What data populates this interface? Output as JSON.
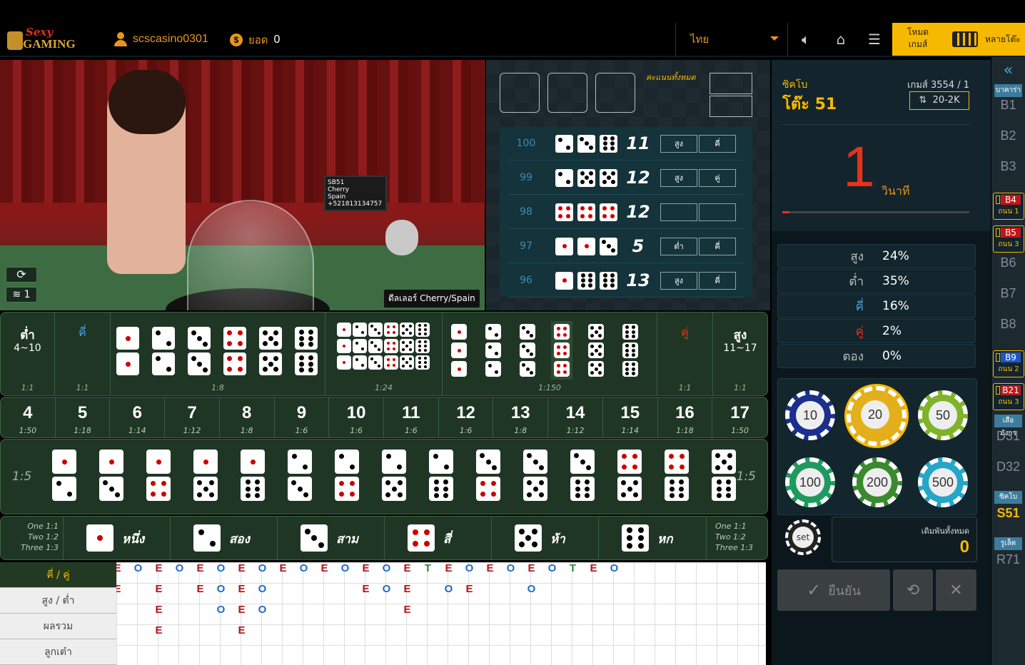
{
  "topbar": {
    "logo_line1": "Sexy",
    "logo_line2": "GAMING",
    "username": "scscasino0301",
    "balance_label": "ยอด",
    "balance_value": "0",
    "language": "ไทย",
    "game_mode": "โหมด\nเกมส์",
    "multi_table": "หลายโต๊ะ"
  },
  "video": {
    "dealer_label": "ดีลเลอร์ Cherry/Spain",
    "signal_level": "1",
    "screen_text": "SB51\nCherry\nSpain\n+521813134757"
  },
  "results": {
    "score_label": "คะแนนทั้งหมด",
    "history": [
      {
        "round": "100",
        "dice": [
          2,
          3,
          6
        ],
        "sum": "11",
        "hl": "สูง",
        "oe": "คี่"
      },
      {
        "round": "99",
        "dice": [
          2,
          5,
          5
        ],
        "sum": "12",
        "hl": "สูง",
        "oe": "คู่"
      },
      {
        "round": "98",
        "dice": [
          4,
          4,
          4
        ],
        "sum": "12",
        "hl": "",
        "oe": ""
      },
      {
        "round": "97",
        "dice": [
          1,
          1,
          3
        ],
        "sum": "5",
        "hl": "ต่ำ",
        "oe": "คี่"
      },
      {
        "round": "96",
        "dice": [
          1,
          6,
          6
        ],
        "sum": "13",
        "hl": "สูง",
        "oe": "คี่"
      }
    ]
  },
  "board": {
    "low_label": "ต่ำ",
    "low_range": "4~10",
    "low_odds": "1:1",
    "odd_label": "คี่",
    "odd_odds": "1:1",
    "double_odds": "1:8",
    "any_triple_odds": "1:24",
    "triple_odds": "1:150",
    "even_label": "คู่",
    "even_odds": "1:1",
    "high_label": "สูง",
    "high_range": "11~17",
    "high_odds": "1:1",
    "sums": [
      {
        "n": "4",
        "o": "1:50"
      },
      {
        "n": "5",
        "o": "1:18"
      },
      {
        "n": "6",
        "o": "1:14"
      },
      {
        "n": "7",
        "o": "1:12"
      },
      {
        "n": "8",
        "o": "1:8"
      },
      {
        "n": "9",
        "o": "1:6"
      },
      {
        "n": "10",
        "o": "1:6"
      },
      {
        "n": "11",
        "o": "1:6"
      },
      {
        "n": "12",
        "o": "1:6"
      },
      {
        "n": "13",
        "o": "1:8"
      },
      {
        "n": "14",
        "o": "1:12"
      },
      {
        "n": "15",
        "o": "1:14"
      },
      {
        "n": "16",
        "o": "1:18"
      },
      {
        "n": "17",
        "o": "1:50"
      }
    ],
    "combo_odds": "1:5",
    "single_odds_text": [
      "One 1:1",
      "Two 1:2",
      "Three 1:3"
    ],
    "singles": [
      "หนึ่ง",
      "สอง",
      "สาม",
      "สี่",
      "ห้า",
      "หก"
    ]
  },
  "roadmap": {
    "tabs": [
      "คี่ / คู่",
      "สูง / ต่ำ",
      "ผลรวม",
      "ลูกเต๋า"
    ],
    "row1": [
      "E",
      "O",
      "E",
      "O",
      "E",
      "O",
      "E",
      "O",
      "E",
      "O",
      "E",
      "O",
      "E",
      "O",
      "E",
      "T",
      "E",
      "O",
      "E",
      "O",
      "E",
      "O",
      "T",
      "E",
      "O"
    ],
    "row2": [
      "E",
      "",
      "E",
      "",
      "E",
      "O",
      "E",
      "O",
      "",
      "",
      "",
      "",
      "E",
      "O",
      "E",
      "",
      "O",
      "E",
      "",
      "",
      "O",
      "",
      "",
      "",
      ""
    ],
    "row3": [
      "",
      "",
      "E",
      "",
      "",
      "O",
      "E",
      "O",
      "",
      "",
      "",
      "",
      "",
      "",
      "E",
      "",
      "",
      "",
      "",
      "",
      "",
      "",
      "",
      "",
      ""
    ],
    "row4": [
      "",
      "",
      "E",
      "",
      "",
      "",
      "E",
      "",
      "",
      "",
      "",
      "",
      "",
      "",
      "",
      "",
      "",
      "",
      "",
      "",
      "",
      "",
      "",
      "",
      ""
    ]
  },
  "table_info": {
    "game_type": "ซิคโบ",
    "table_name": "โต๊ะ 51",
    "game_no": "เกมส์ 3554 / 1",
    "limit": "20-2K",
    "timer": "1",
    "timer_unit": "วินาที",
    "timer_fraction": 0.04
  },
  "stats": [
    {
      "k": "สูง",
      "v": "24%"
    },
    {
      "k": "ต่ำ",
      "v": "35%"
    },
    {
      "k": "คี่",
      "v": "16%"
    },
    {
      "k": "คู่",
      "v": "2%"
    },
    {
      "k": "ตอง",
      "v": "0%"
    }
  ],
  "chips": [
    "10",
    "20",
    "50",
    "100",
    "200",
    "500"
  ],
  "set_label": "set",
  "bet_total_label": "เดิมพันทั้งหมด",
  "bet_total_value": "0",
  "confirm_label": "ยืนยัน",
  "rail": {
    "baccarat_label": "บาคาร่า",
    "b": [
      "B1",
      "B2",
      "B3",
      "B4",
      "B5",
      "B6",
      "B7",
      "B8",
      "B9",
      "B21"
    ],
    "b4_sub": "ถนน 1",
    "b5_sub": "ถนน 3",
    "b9_sub": "ถนน 2",
    "b21_sub": "ถนน 3",
    "dragon_label": "เสือ มังกร",
    "d": [
      "D31",
      "D32"
    ],
    "sicbo_label": "ซิคโบ",
    "s": "S51",
    "roulette_label": "รูเล็ต",
    "r": "R71"
  }
}
